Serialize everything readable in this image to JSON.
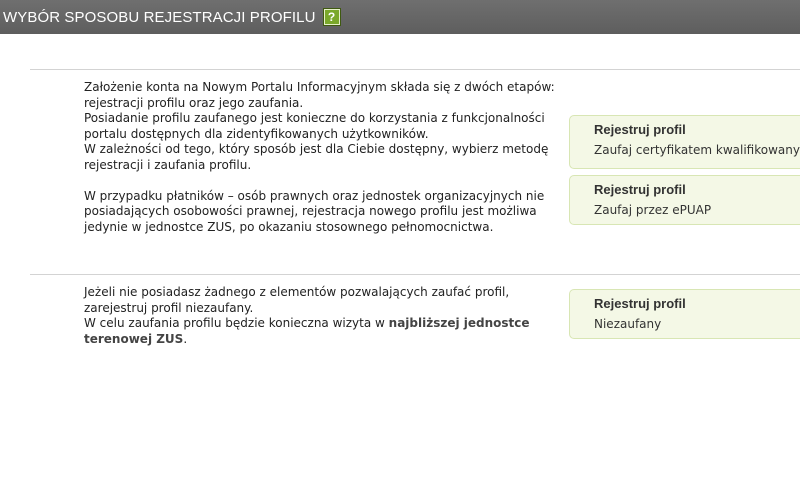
{
  "header": {
    "title": "WYBÓR SPOSOBU REJESTRACJI PROFILU",
    "help_icon": "question-mark-icon",
    "help_glyph": "?"
  },
  "section1": {
    "paragraphs": [
      "Założenie konta na Nowym Portalu Informacyjnym składa się z dwóch etapów:",
      "rejestracji profilu oraz jego zaufania.",
      "Posiadanie profilu zaufanego jest konieczne do korzystania z funkcjonalności",
      "portalu dostępnych dla zidentyfikowanych użytkowników.",
      "W zależności od tego, który sposób jest dla Ciebie dostępny, wybierz metodę",
      "rejestracji i zaufania profilu."
    ],
    "note": [
      "W przypadku płatników – osób prawnych oraz jednostek organizacyjnych nie",
      "posiadających osobowości prawnej, rejestracja nowego profilu jest możliwa",
      "jedynie w jednostce ZUS, po okazaniu stosownego pełnomocnictwa."
    ],
    "options": [
      {
        "title": "Rejestruj profil",
        "subtitle": "Zaufaj certyfikatem kwalifikowanym"
      },
      {
        "title": "Rejestruj profil",
        "subtitle": "Zaufaj przez ePUAP"
      }
    ]
  },
  "section2": {
    "lines": [
      "Jeżeli nie posiadasz żadnego z elementów pozwalających zaufać profil,",
      "zarejestruj profil niezaufany."
    ],
    "visit_prefix": "W celu zaufania profilu będzie konieczna wizyta w ",
    "visit_bold_1": "najbliższej jednostce",
    "visit_bold_2": "terenowej ZUS",
    "visit_suffix": ".",
    "option": {
      "title": "Rejestruj profil",
      "subtitle": "Niezaufany"
    }
  },
  "colors": {
    "header_bg": "#666666",
    "option_bg": "#f4f8e6",
    "option_border": "#d8e6b4",
    "help_icon_bg": "#7aa82a"
  }
}
